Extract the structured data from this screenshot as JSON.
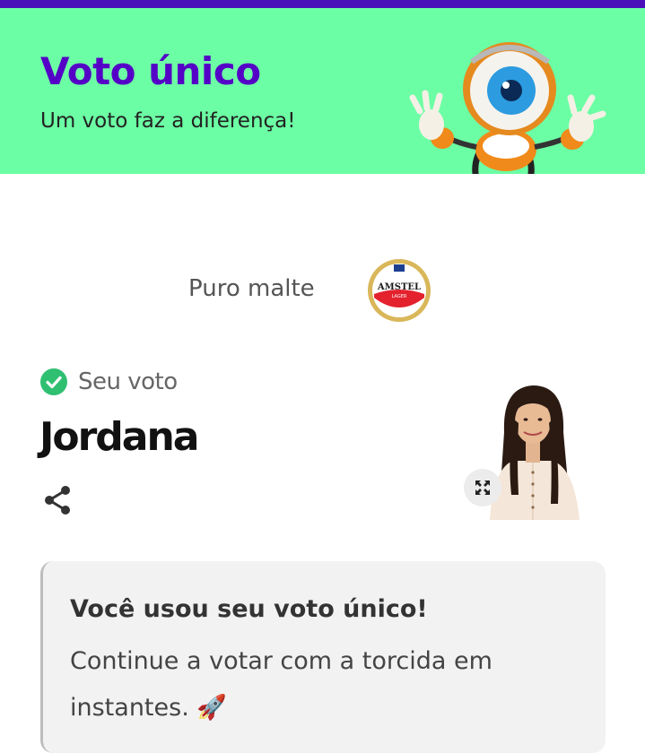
{
  "header": {
    "title": "Voto único",
    "subtitle": "Um voto faz a diferença!",
    "mascot_icon": "big-brother-eye-mascot",
    "background_color": "#6cfea4",
    "accent_color": "#5400c6",
    "topbar_color": "#4a0fb8"
  },
  "sponsor": {
    "text": "Puro malte",
    "logo_brand": "AMSTEL",
    "logo_sub": "LAGER"
  },
  "vote": {
    "status_label": "Seu voto",
    "status_color": "#2fbf71",
    "candidate_name": "Jordana",
    "share_icon": "share-icon",
    "expand_icon": "expand-icon"
  },
  "info": {
    "title": "Você usou seu voto único!",
    "text": "Continue a votar com a torcida em instantes. 🚀"
  }
}
